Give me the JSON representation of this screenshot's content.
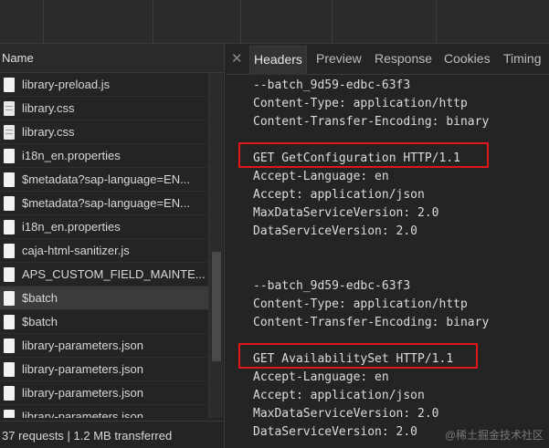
{
  "name_header": "Name",
  "requests": [
    {
      "label": "library-preload.js",
      "icon": "js-file-icon"
    },
    {
      "label": "library.css",
      "icon": "css-file-icon"
    },
    {
      "label": "library.css",
      "icon": "css-file-icon"
    },
    {
      "label": "i18n_en.properties",
      "icon": "file-icon"
    },
    {
      "label": "$metadata?sap-language=EN...",
      "icon": "file-icon"
    },
    {
      "label": "$metadata?sap-language=EN...",
      "icon": "file-icon"
    },
    {
      "label": "i18n_en.properties",
      "icon": "file-icon"
    },
    {
      "label": "caja-html-sanitizer.js",
      "icon": "js-file-icon"
    },
    {
      "label": "APS_CUSTOM_FIELD_MAINTE...",
      "icon": "file-icon"
    },
    {
      "label": "$batch",
      "icon": "batch-file-icon"
    },
    {
      "label": "$batch",
      "icon": "file-icon"
    },
    {
      "label": "library-parameters.json",
      "icon": "file-icon"
    },
    {
      "label": "library-parameters.json",
      "icon": "file-icon"
    },
    {
      "label": "library-parameters.json",
      "icon": "file-icon"
    },
    {
      "label": "library-parameters.json",
      "icon": "file-icon"
    }
  ],
  "selected_index": 9,
  "footer": "37 requests  |  1.2 MB transferred",
  "tabs": [
    "Headers",
    "Preview",
    "Response",
    "Cookies",
    "Timing"
  ],
  "active_tab": "Headers",
  "payload_lines": [
    "--batch_9d59-edbc-63f3",
    "Content-Type: application/http",
    "Content-Transfer-Encoding: binary",
    "",
    "GET GetConfiguration HTTP/1.1",
    "Accept-Language: en",
    "Accept: application/json",
    "MaxDataServiceVersion: 2.0",
    "DataServiceVersion: 2.0",
    "",
    "",
    "--batch_9d59-edbc-63f3",
    "Content-Type: application/http",
    "Content-Transfer-Encoding: binary",
    "",
    "GET AvailabilitySet HTTP/1.1",
    "Accept-Language: en",
    "Accept: application/json",
    "MaxDataServiceVersion: 2.0",
    "DataServiceVersion: 2.0"
  ],
  "watermark": "@稀土掘金技术社区",
  "colors": {
    "highlight": "#e0161b",
    "background": "#242424"
  }
}
